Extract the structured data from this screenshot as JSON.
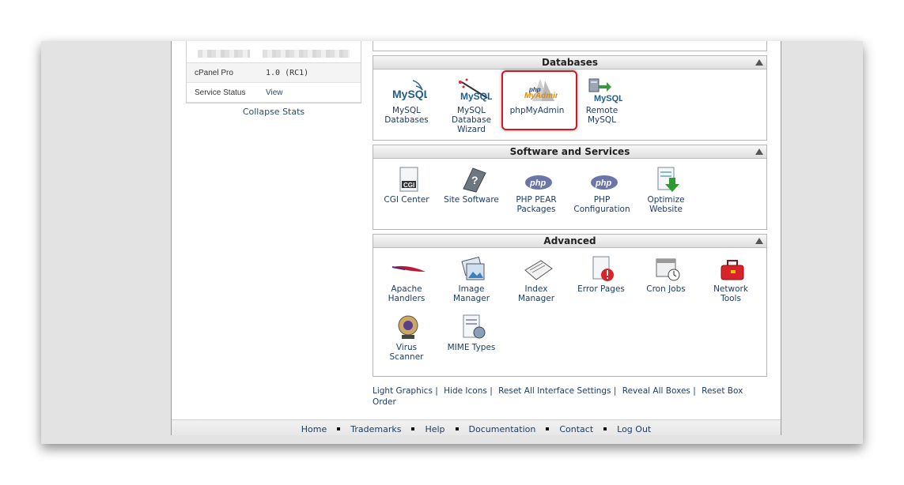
{
  "stats": {
    "rows": [
      {
        "label": "cPanel Pro",
        "value": "1.0 (RC1)"
      },
      {
        "label": "Service Status",
        "value": "View"
      }
    ],
    "collapse_label": "Collapse Stats"
  },
  "panels": {
    "databases": {
      "title": "Databases",
      "items": [
        {
          "lines": [
            "MySQL",
            "Databases"
          ]
        },
        {
          "lines": [
            "MySQL",
            "Database",
            "Wizard"
          ]
        },
        {
          "lines": [
            "phpMyAdmin"
          ]
        },
        {
          "lines": [
            "Remote",
            "MySQL"
          ]
        }
      ],
      "logo_texts": {
        "mysql": "MySQL",
        "php": "php",
        "myadmin": "MyAdmin"
      }
    },
    "software": {
      "title": "Software and Services",
      "items": [
        {
          "lines": [
            "CGI Center"
          ]
        },
        {
          "lines": [
            "Site Software"
          ]
        },
        {
          "lines": [
            "PHP PEAR",
            "Packages"
          ]
        },
        {
          "lines": [
            "PHP",
            "Configuration"
          ]
        },
        {
          "lines": [
            "Optimize",
            "Website"
          ]
        }
      ],
      "logo_texts": {
        "cgi": "CGI",
        "php": "php"
      }
    },
    "advanced": {
      "title": "Advanced",
      "items": [
        {
          "lines": [
            "Apache",
            "Handlers"
          ]
        },
        {
          "lines": [
            "Image",
            "Manager"
          ]
        },
        {
          "lines": [
            "Index",
            "Manager"
          ]
        },
        {
          "lines": [
            "Error Pages"
          ]
        },
        {
          "lines": [
            "Cron Jobs"
          ]
        },
        {
          "lines": [
            "Network",
            "Tools"
          ]
        },
        {
          "lines": [
            "Virus",
            "Scanner"
          ]
        },
        {
          "lines": [
            "MIME Types"
          ]
        }
      ]
    }
  },
  "bottom_links": [
    "Light Graphics",
    "Hide Icons",
    "Reset All Interface Settings",
    "Reveal All Boxes",
    "Reset Box Order"
  ],
  "link_separator": "|",
  "footer_links": [
    "Home",
    "Trademarks",
    "Help",
    "Documentation",
    "Contact",
    "Log Out"
  ],
  "colors": {
    "link": "#1d3c66",
    "highlight": "#d11a1a"
  }
}
